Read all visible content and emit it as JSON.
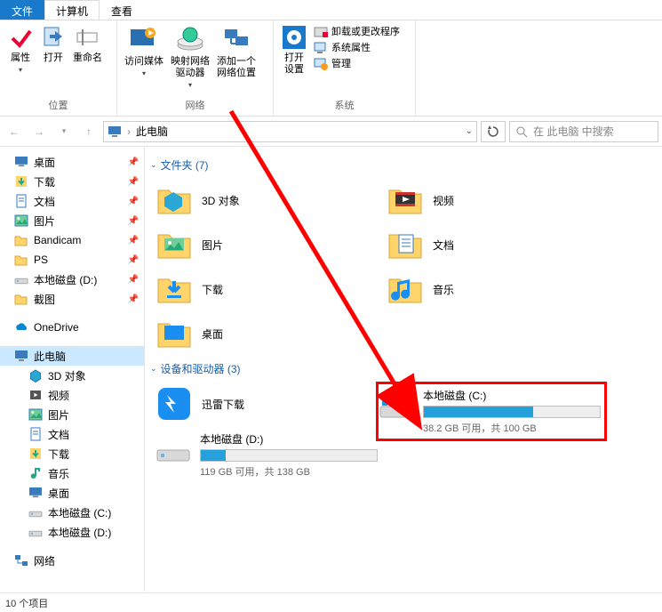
{
  "tabs": {
    "file": "文件",
    "computer": "计算机",
    "view": "查看"
  },
  "ribbon": {
    "grp_loc": "位置",
    "grp_net": "网络",
    "grp_sys": "系统",
    "props": "属性",
    "open": "打开",
    "rename": "重命名",
    "media": "访问媒体",
    "mapnet": "映射网络\n驱动器",
    "addloc": "添加一个\n网络位置",
    "open_settings": "打开\n设置",
    "uninstall": "卸载或更改程序",
    "sysprops": "系统属性",
    "manage": "管理"
  },
  "nav": {
    "back": "←",
    "fwd": "→",
    "up": "↑",
    "crumb_root": "此电脑",
    "search_placeholder": "在 此电脑 中搜索"
  },
  "sidebar": {
    "quick": [
      {
        "label": "桌面",
        "icon": "desktop"
      },
      {
        "label": "下载",
        "icon": "download"
      },
      {
        "label": "文档",
        "icon": "doc"
      },
      {
        "label": "图片",
        "icon": "pic"
      },
      {
        "label": "Bandicam",
        "icon": "folder"
      },
      {
        "label": "PS",
        "icon": "folder"
      },
      {
        "label": "本地磁盘 (D:)",
        "icon": "drive"
      },
      {
        "label": "截图",
        "icon": "folder"
      }
    ],
    "onedrive": "OneDrive",
    "thispc": "此电脑",
    "pc": [
      {
        "label": "3D 对象",
        "icon": "3d"
      },
      {
        "label": "视频",
        "icon": "video"
      },
      {
        "label": "图片",
        "icon": "pic"
      },
      {
        "label": "文档",
        "icon": "doc"
      },
      {
        "label": "下载",
        "icon": "download"
      },
      {
        "label": "音乐",
        "icon": "music"
      },
      {
        "label": "桌面",
        "icon": "desktop"
      },
      {
        "label": "本地磁盘 (C:)",
        "icon": "drive"
      },
      {
        "label": "本地磁盘 (D:)",
        "icon": "drive"
      }
    ],
    "network": "网络"
  },
  "sections": {
    "folders": "文件夹 (7)",
    "devices": "设备和驱动器 (3)"
  },
  "folders_left": [
    {
      "label": "3D 对象",
      "icon": "3d"
    },
    {
      "label": "图片",
      "icon": "pic"
    },
    {
      "label": "下载",
      "icon": "download"
    },
    {
      "label": "桌面",
      "icon": "desktop"
    }
  ],
  "folders_right": [
    {
      "label": "视频",
      "icon": "video"
    },
    {
      "label": "文档",
      "icon": "doc"
    },
    {
      "label": "音乐",
      "icon": "music"
    }
  ],
  "devices": {
    "xunlei": "迅雷下载",
    "c": {
      "name": "本地磁盘 (C:)",
      "free_text": "38.2 GB 可用，共 100 GB",
      "pct": 62
    },
    "d": {
      "name": "本地磁盘 (D:)",
      "free_text": "119 GB 可用，共 138 GB",
      "pct": 14
    }
  },
  "status": "10 个项目"
}
